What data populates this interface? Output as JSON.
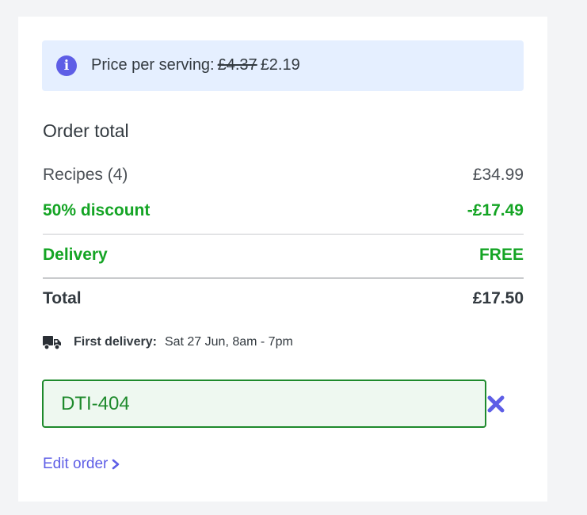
{
  "banner": {
    "label": "Price per serving:",
    "old_price": "£4.37",
    "new_price": "£2.19",
    "icon": "info-icon"
  },
  "order": {
    "title": "Order total",
    "recipes_label": "Recipes (4)",
    "recipes_value": "£34.99",
    "discount_label": "50% discount",
    "discount_value": "-£17.49",
    "delivery_label": "Delivery",
    "delivery_value": "FREE",
    "total_label": "Total",
    "total_value": "£17.50"
  },
  "first_delivery": {
    "label": "First delivery:",
    "value": "Sat 27 Jun, 8am - 7pm",
    "icon": "truck-icon"
  },
  "promo": {
    "code_value": "DTI-404",
    "clear_icon": "close-icon"
  },
  "edit": {
    "label": "Edit order",
    "icon": "chevron-right-icon"
  },
  "colors": {
    "accent": "#5e5ee6",
    "success": "#14a424",
    "banner_bg": "#e5efff",
    "input_bg": "#eef8f0",
    "input_border": "#1e8a2c"
  }
}
